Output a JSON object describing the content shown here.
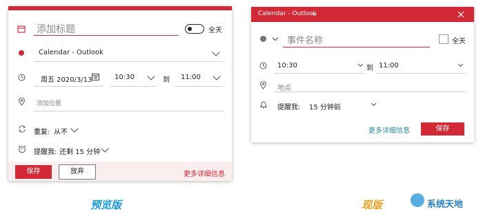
{
  "preview": {
    "title_placeholder": "添加标题",
    "all_day_label": "全天",
    "calendar_name": "Calendar - Outlook",
    "date": "周五 2020/3/13",
    "start_time": "10:30",
    "to_label": "到",
    "end_time": "11:00",
    "location_placeholder": "添加位置",
    "repeat_label": "重复:",
    "repeat_value": "从不",
    "reminder_label": "提醒我:",
    "reminder_value": "还剩 15 分钟",
    "save_label": "保存",
    "discard_label": "放弃",
    "more_details_label": "更多详细信息",
    "caption": "预览版"
  },
  "current": {
    "window_title": "Calendar - Outlook",
    "event_name_placeholder": "事件名称",
    "all_day_label": "全天",
    "start_time": "10:30",
    "to_label": "到",
    "end_time": "11:00",
    "location_placeholder": "地点",
    "reminder_label": "提醒我:",
    "reminder_value": "15 分钟前",
    "more_details_label": "更多详细信息",
    "save_label": "保存",
    "caption": "现版"
  },
  "watermark": {
    "text": "系统天地"
  },
  "colors": {
    "accent_red": "#d12936",
    "link_teal": "#2a8a9a",
    "caption_blue": "#1a9ad6",
    "caption_orange": "#f0a020"
  }
}
